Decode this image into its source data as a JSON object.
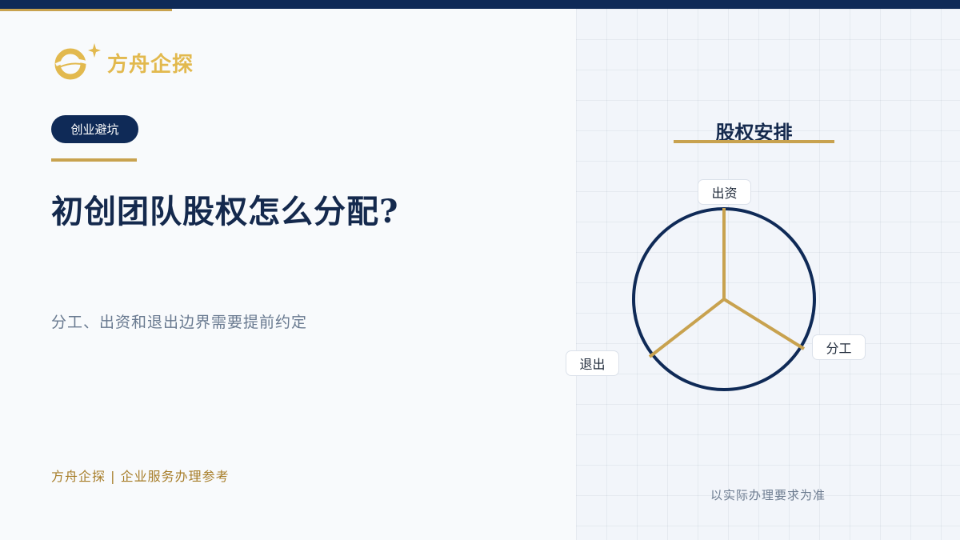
{
  "brand": {
    "name": "方舟企探"
  },
  "tag": {
    "label": "创业避坑"
  },
  "headline": "初创团队股权怎么分配?",
  "subtitle": "分工、出资和退出边界需要提前约定",
  "footer": "方舟企探 | 企业服务办理参考",
  "panel": {
    "title": "股权安排",
    "diagram_labels": [
      "出资",
      "分工",
      "退出"
    ],
    "note": "以实际办理要求为准"
  },
  "colors": {
    "navy": "#0f2a57",
    "gold": "#c8a24f",
    "logo_gold": "#e2b94e"
  },
  "icons": [
    "logo-mark-icon",
    "sparkle-icon"
  ]
}
